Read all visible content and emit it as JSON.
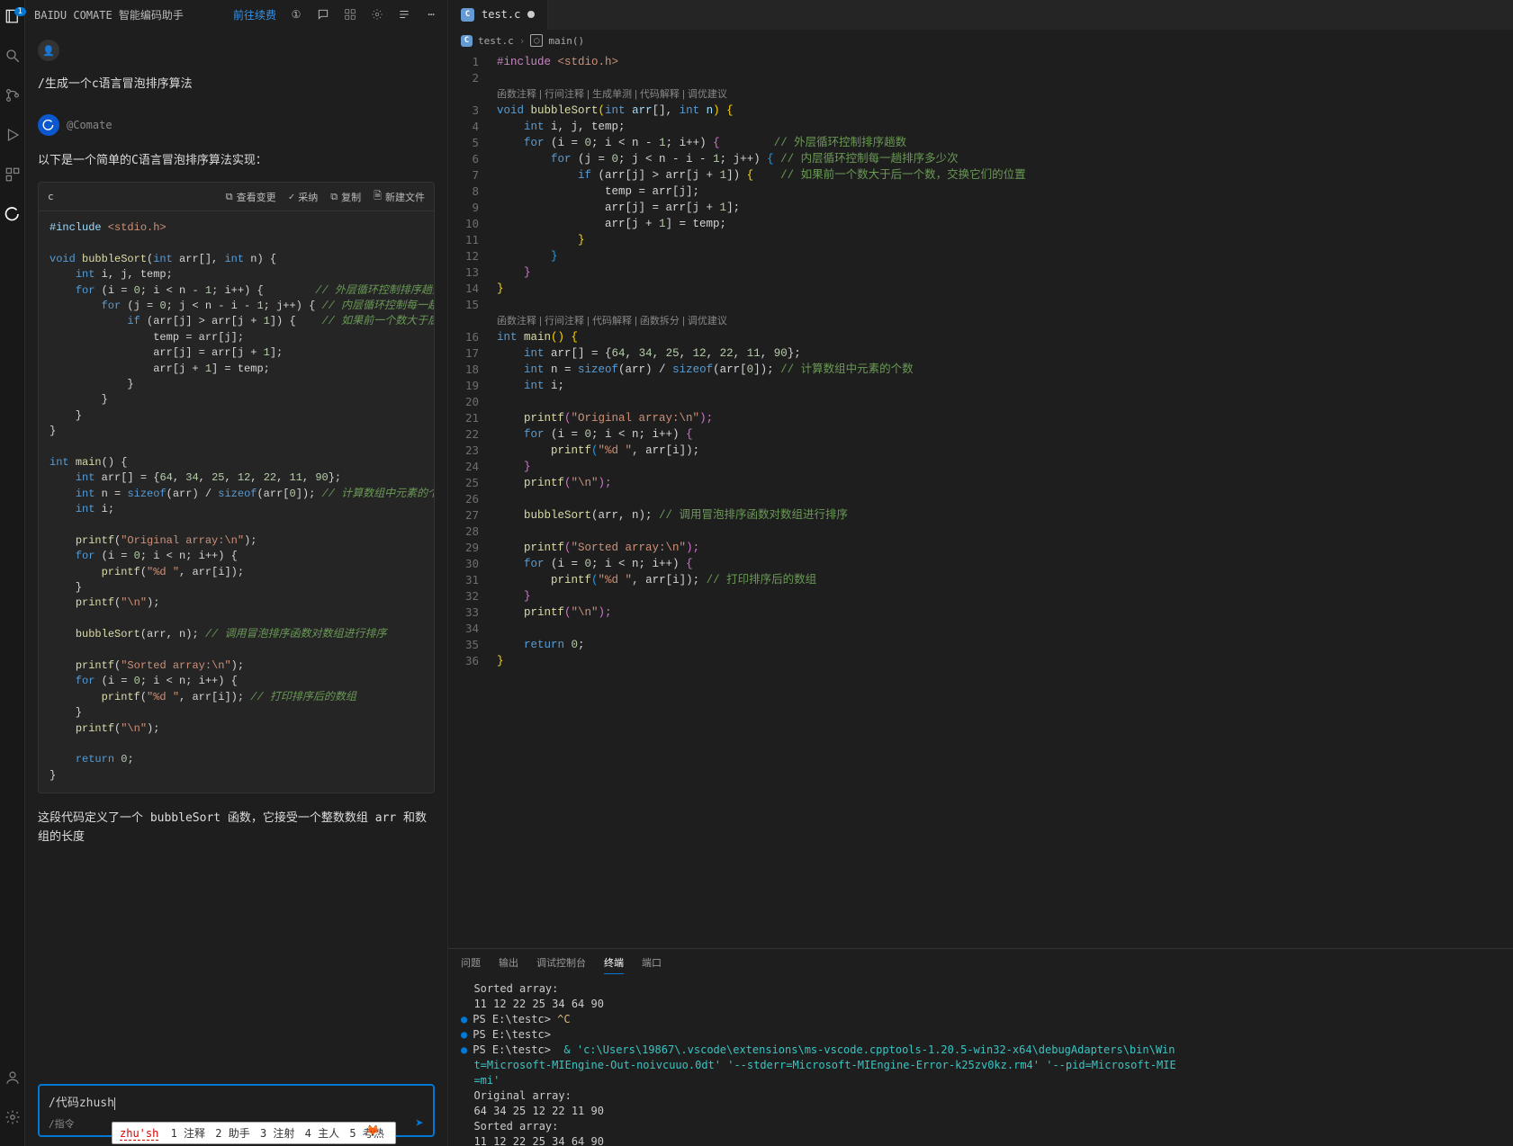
{
  "activity": {
    "badge": "1"
  },
  "comate": {
    "title": "BAIDU COMATE 智能编码助手",
    "renewLink": "前往续费",
    "userPrompt": "/生成一个c语言冒泡排序算法",
    "botName": "@Comate",
    "botIntro": "以下是一个简单的C语言冒泡排序算法实现：",
    "codeLang": "c",
    "actions": {
      "viewDiff": "查看变更",
      "accept": "采纳",
      "copy": "复制",
      "newFile": "新建文件"
    },
    "followup": "这段代码定义了一个 bubbleSort 函数，它接受一个整数数组 arr 和数组的长度",
    "inputText": "/代码zhush",
    "inputHint": "/指令",
    "ime": {
      "pinyin": "zhu'sh",
      "cand1": "1 注释",
      "cand2": "2 助手",
      "cand3": "3 注射",
      "cand4": "4 主人",
      "cand5": "5 考熟"
    }
  },
  "snippet": {
    "line1_a": "#include",
    "line1_b": " <stdio.h>",
    "line3": "void bubbleSort(int arr[], int n) {",
    "line4": "    int i, j, temp;",
    "line5": "    for (i = 0; i < n - 1; i++) {        ",
    "line5c": "// 外层循环控制排序趟数",
    "line6": "        for (j = 0; j < n - i - 1; j++) { ",
    "line6c": "// 内层循环控制每一趟排序多少",
    "line7": "            if (arr[j] > arr[j + 1]) {    ",
    "line7c": "// 如果前一个数大于后一个数，",
    "line8": "                temp = arr[j];",
    "line9": "                arr[j] = arr[j + 1];",
    "line10": "                arr[j + 1] = temp;",
    "line11": "            }",
    "line12": "        }",
    "line13": "    }",
    "line14": "}",
    "line16": "int main() {",
    "line17": "    int arr[] = {64, 34, 25, 12, 22, 11, 90};",
    "line18": "    int n = sizeof(arr) / sizeof(arr[0]); ",
    "line18c": "// 计算数组中元素的个数",
    "line19": "    int i;",
    "line21": "    printf(\"Original array:\\n\");",
    "line22": "    for (i = 0; i < n; i++) {",
    "line23": "        printf(\"%d \", arr[i]);",
    "line24": "    }",
    "line25": "    printf(\"\\n\");",
    "line27": "    bubbleSort(arr, n); ",
    "line27c": "// 调用冒泡排序函数对数组进行排序",
    "line29": "    printf(\"Sorted array:\\n\");",
    "line30": "    for (i = 0; i < n; i++) {",
    "line31": "        printf(\"%d \", arr[i]); ",
    "line31c": "// 打印排序后的数组",
    "line32": "    }",
    "line33": "    printf(\"\\n\");",
    "line35": "    return 0;",
    "line36": "}"
  },
  "editor": {
    "tabName": "test.c",
    "bcFile": "test.c",
    "bcFn": "main()",
    "codeLens1": "函数注释 | 行间注释 | 生成单测 | 代码解释 | 调优建议",
    "codeLens2": "函数注释 | 行间注释 | 代码解释 | 函数拆分 | 调优建议",
    "lineNumbers": [
      "1",
      "2",
      "",
      "3",
      "4",
      "5",
      "6",
      "7",
      "8",
      "9",
      "10",
      "11",
      "12",
      "13",
      "14",
      "15",
      "",
      "16",
      "17",
      "18",
      "19",
      "20",
      "21",
      "22",
      "23",
      "24",
      "25",
      "26",
      "27",
      "28",
      "29",
      "30",
      "31",
      "32",
      "33",
      "34",
      "35",
      "36"
    ]
  },
  "code": {
    "l1a": "#include",
    "l1b": " <stdio.h>",
    "l3a": "void",
    "l3b": " bubbleSort",
    "l3c": "(",
    "l3d": "int",
    "l3e": " arr",
    "l3f": "[], ",
    "l3g": "int",
    "l3h": " n",
    "l3i": ") ",
    "l3j": "{",
    "l4a": "    int",
    "l4b": " i, j, temp;",
    "l5a": "    for",
    "l5b": " (i = ",
    "l5c": "0",
    "l5d": "; i < n - ",
    "l5e": "1",
    "l5f": "; i++) ",
    "l5g": "{",
    "l5h": "        // 外层循环控制排序趟数",
    "l6a": "        for",
    "l6b": " (j = ",
    "l6c": "0",
    "l6d": "; j < n - i - ",
    "l6e": "1",
    "l6f": "; j++) ",
    "l6g": "{",
    "l6h": " // 内层循环控制每一趟排序多少次",
    "l7a": "            if",
    "l7b": " (arr[j] > arr[j + ",
    "l7c": "1",
    "l7d": "]) ",
    "l7e": "{",
    "l7f": "    // 如果前一个数大于后一个数，交换它们的位置",
    "l8": "                temp = arr[j];",
    "l9": "                arr[j] = arr[j + ",
    "l9b": "1",
    "l9c": "];",
    "l10": "                arr[j + ",
    "l10b": "1",
    "l10c": "] = temp;",
    "l11": "            }",
    "l12": "        }",
    "l13": "    }",
    "l14": "}",
    "l16a": "int",
    "l16b": " main",
    "l16c": "() ",
    "l16d": "{",
    "l17a": "    int",
    "l17b": " arr[] = {",
    "l17c": "64",
    "l17d": ", ",
    "l17e": "34",
    "l17f": ", ",
    "l17g": "25",
    "l17h": ", ",
    "l17i": "12",
    "l17j": ", ",
    "l17k": "22",
    "l17l": ", ",
    "l17m": "11",
    "l17n": ", ",
    "l17o": "90",
    "l17p": "};",
    "l18a": "    int",
    "l18b": " n = ",
    "l18c": "sizeof",
    "l18d": "(arr) / ",
    "l18e": "sizeof",
    "l18f": "(arr[",
    "l18g": "0",
    "l18h": "]); ",
    "l18i": "// 计算数组中元素的个数",
    "l19a": "    int",
    "l19b": " i;",
    "l21a": "    printf",
    "l21b": "(",
    "l21c": "\"Original array:\\n\"",
    "l21d": ");",
    "l22a": "    for",
    "l22b": " (i = ",
    "l22c": "0",
    "l22d": "; i < n; i++) ",
    "l22e": "{",
    "l23a": "        printf",
    "l23b": "(",
    "l23c": "\"%d \"",
    "l23d": ", arr[i]);",
    "l24": "    }",
    "l25a": "    printf",
    "l25b": "(",
    "l25c": "\"\\n\"",
    "l25d": ");",
    "l27a": "    bubbleSort",
    "l27b": "(arr, n); ",
    "l27c": "// 调用冒泡排序函数对数组进行排序",
    "l29a": "    printf",
    "l29b": "(",
    "l29c": "\"Sorted array:\\n\"",
    "l29d": ");",
    "l30a": "    for",
    "l30b": " (i = ",
    "l30c": "0",
    "l30d": "; i < n; i++) ",
    "l30e": "{",
    "l31a": "        printf",
    "l31b": "(",
    "l31c": "\"%d \"",
    "l31d": ", arr[i]); ",
    "l31e": "// 打印排序后的数组",
    "l32": "    }",
    "l33a": "    printf",
    "l33b": "(",
    "l33c": "\"\\n\"",
    "l33d": ");",
    "l35a": "    return",
    "l35b": " ",
    "l35c": "0",
    "l35d": ";",
    "l36": "}"
  },
  "terminal": {
    "tabs": {
      "problems": "问题",
      "output": "输出",
      "debugConsole": "调试控制台",
      "terminal": "终端",
      "ports": "端口"
    },
    "lines": {
      "t0": "Sorted array:",
      "t1": "11 12 22 25 34 64 90",
      "t2p": "PS E:\\testc> ",
      "t2c": "^C",
      "t3": "PS E:\\testc>",
      "t4p": "PS E:\\testc>  ",
      "t4a": "& 'c:\\Users\\19867\\.vscode\\extensions\\ms-vscode.cpptools-1.20.5-win32-x64\\debugAdapters\\bin\\Win",
      "t5": "t=Microsoft-MIEngine-Out-noivcuuo.0dt' '--stderr=Microsoft-MIEngine-Error-k25zv0kz.rm4' '--pid=Microsoft-MIE",
      "t6": "=mi'",
      "t7": "Original array:",
      "t8": "64 34 25 12 22 11 90",
      "t9": "Sorted array:",
      "t10": "11 12 22 25 34 64 90"
    }
  }
}
